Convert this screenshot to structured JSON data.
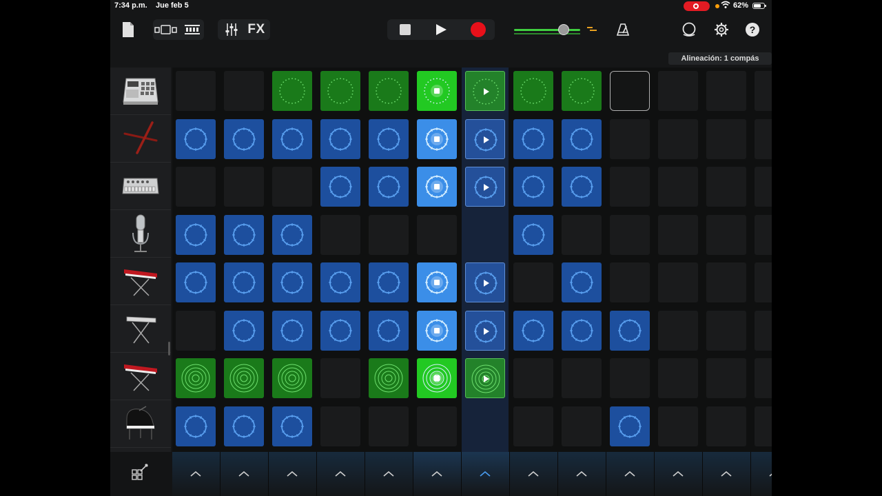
{
  "status": {
    "time": "7:34 p.m.",
    "date": "Jue feb 5",
    "battery": "62%",
    "accent": "#e31b23"
  },
  "toolbar": {
    "fx_label": "FX",
    "alignment_label": "Alineación: 1 compás",
    "volume_level": 0.75
  },
  "icons": [
    "document-icon",
    "view-toggle-icon",
    "tracks-view-icon",
    "mixer-icon",
    "stop-icon",
    "play-icon",
    "record-icon",
    "metronome-icon",
    "loop-browser-icon",
    "settings-icon",
    "help-icon",
    "edit-cells-icon"
  ],
  "instruments": [
    {
      "name": "drum-machine-mpc-icon"
    },
    {
      "name": "drumsticks-icon"
    },
    {
      "name": "drum-machine-808-icon"
    },
    {
      "name": "microphone-icon"
    },
    {
      "name": "red-synth-keyboard-icon"
    },
    {
      "name": "keyboard-stand-icon"
    },
    {
      "name": "red-synth-keyboard-icon"
    },
    {
      "name": "grand-piano-icon"
    }
  ],
  "grid": [
    [
      "empty",
      "empty",
      "green",
      "green",
      "green",
      "green-act",
      "green-q",
      "green",
      "green",
      "outline",
      "empty",
      "empty",
      "empty"
    ],
    [
      "blue",
      "blue",
      "blue",
      "blue",
      "blue",
      "blue-act",
      "blue-q",
      "blue",
      "blue",
      "empty",
      "empty",
      "empty",
      "empty"
    ],
    [
      "empty",
      "empty",
      "empty",
      "blue",
      "blue",
      "blue-act",
      "blue-q",
      "blue",
      "blue",
      "empty",
      "empty",
      "empty",
      "empty"
    ],
    [
      "blue",
      "blue",
      "blue",
      "empty",
      "empty",
      "empty",
      "none",
      "blue",
      "empty",
      "empty",
      "empty",
      "empty",
      "empty"
    ],
    [
      "blue",
      "blue",
      "blue",
      "blue",
      "blue",
      "blue-act",
      "blue-q",
      "empty",
      "blue",
      "empty",
      "empty",
      "empty",
      "empty"
    ],
    [
      "empty",
      "blue",
      "blue",
      "blue",
      "blue",
      "blue-act",
      "blue-q",
      "blue",
      "blue",
      "blue",
      "empty",
      "empty",
      "empty"
    ],
    [
      "green",
      "green",
      "green",
      "empty",
      "green",
      "green-act",
      "green-q",
      "empty",
      "empty",
      "empty",
      "empty",
      "empty",
      "empty"
    ],
    [
      "blue",
      "blue",
      "blue",
      "empty",
      "empty",
      "empty",
      "none",
      "empty",
      "empty",
      "blue",
      "empty",
      "empty",
      "empty"
    ]
  ],
  "active_column": 5,
  "queued_column": 6,
  "column_triggers": 13,
  "colors": {
    "blue": "#1d4f9e",
    "blue_active": "#3b8ee8",
    "green": "#1a7a1a",
    "green_active": "#22c922"
  }
}
